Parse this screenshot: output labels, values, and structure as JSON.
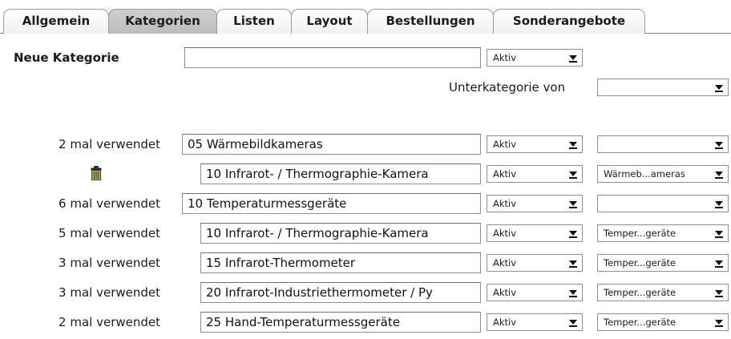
{
  "tabs": [
    {
      "label": "Allgemein",
      "active": false
    },
    {
      "label": "Kategorien",
      "active": true
    },
    {
      "label": "Listen",
      "active": false
    },
    {
      "label": "Layout",
      "active": false
    },
    {
      "label": "Bestellungen",
      "active": false
    },
    {
      "label": "Sonderangebote",
      "active": false
    }
  ],
  "new_category": {
    "label": "Neue Kategorie",
    "name_value": "",
    "status_value": "Aktiv",
    "parent_label": "Unterkategorie von",
    "parent_value": ""
  },
  "categories": [
    {
      "usage": "2 mal verwendet",
      "name": "05 Wärmebildkameras",
      "status": "Aktiv",
      "parent": "",
      "indent": false,
      "delete_icon": false
    },
    {
      "usage": "",
      "name": "10 Infrarot- / Thermographie-Kamera",
      "status": "Aktiv",
      "parent": "Wärmeb...ameras",
      "indent": true,
      "delete_icon": true
    },
    {
      "usage": "6 mal verwendet",
      "name": "10 Temperaturmessgeräte",
      "status": "Aktiv",
      "parent": "",
      "indent": false,
      "delete_icon": false
    },
    {
      "usage": "5 mal verwendet",
      "name": "10 Infrarot- / Thermographie-Kamera",
      "status": "Aktiv",
      "parent": "Temper...geräte",
      "indent": true,
      "delete_icon": false
    },
    {
      "usage": "3 mal verwendet",
      "name": "15 Infrarot-Thermometer",
      "status": "Aktiv",
      "parent": "Temper...geräte",
      "indent": true,
      "delete_icon": false
    },
    {
      "usage": "3 mal verwendet",
      "name": "20 Infrarot-Industriethermometer / Py",
      "status": "Aktiv",
      "parent": "Temper...geräte",
      "indent": true,
      "delete_icon": false
    },
    {
      "usage": "2 mal verwendet",
      "name": "25 Hand-Temperaturmessgeräte",
      "status": "Aktiv",
      "parent": "Temper...geräte",
      "indent": true,
      "delete_icon": false
    }
  ],
  "icons": {
    "delete": "trash-icon",
    "dropdown": "chevron-down-icon"
  }
}
